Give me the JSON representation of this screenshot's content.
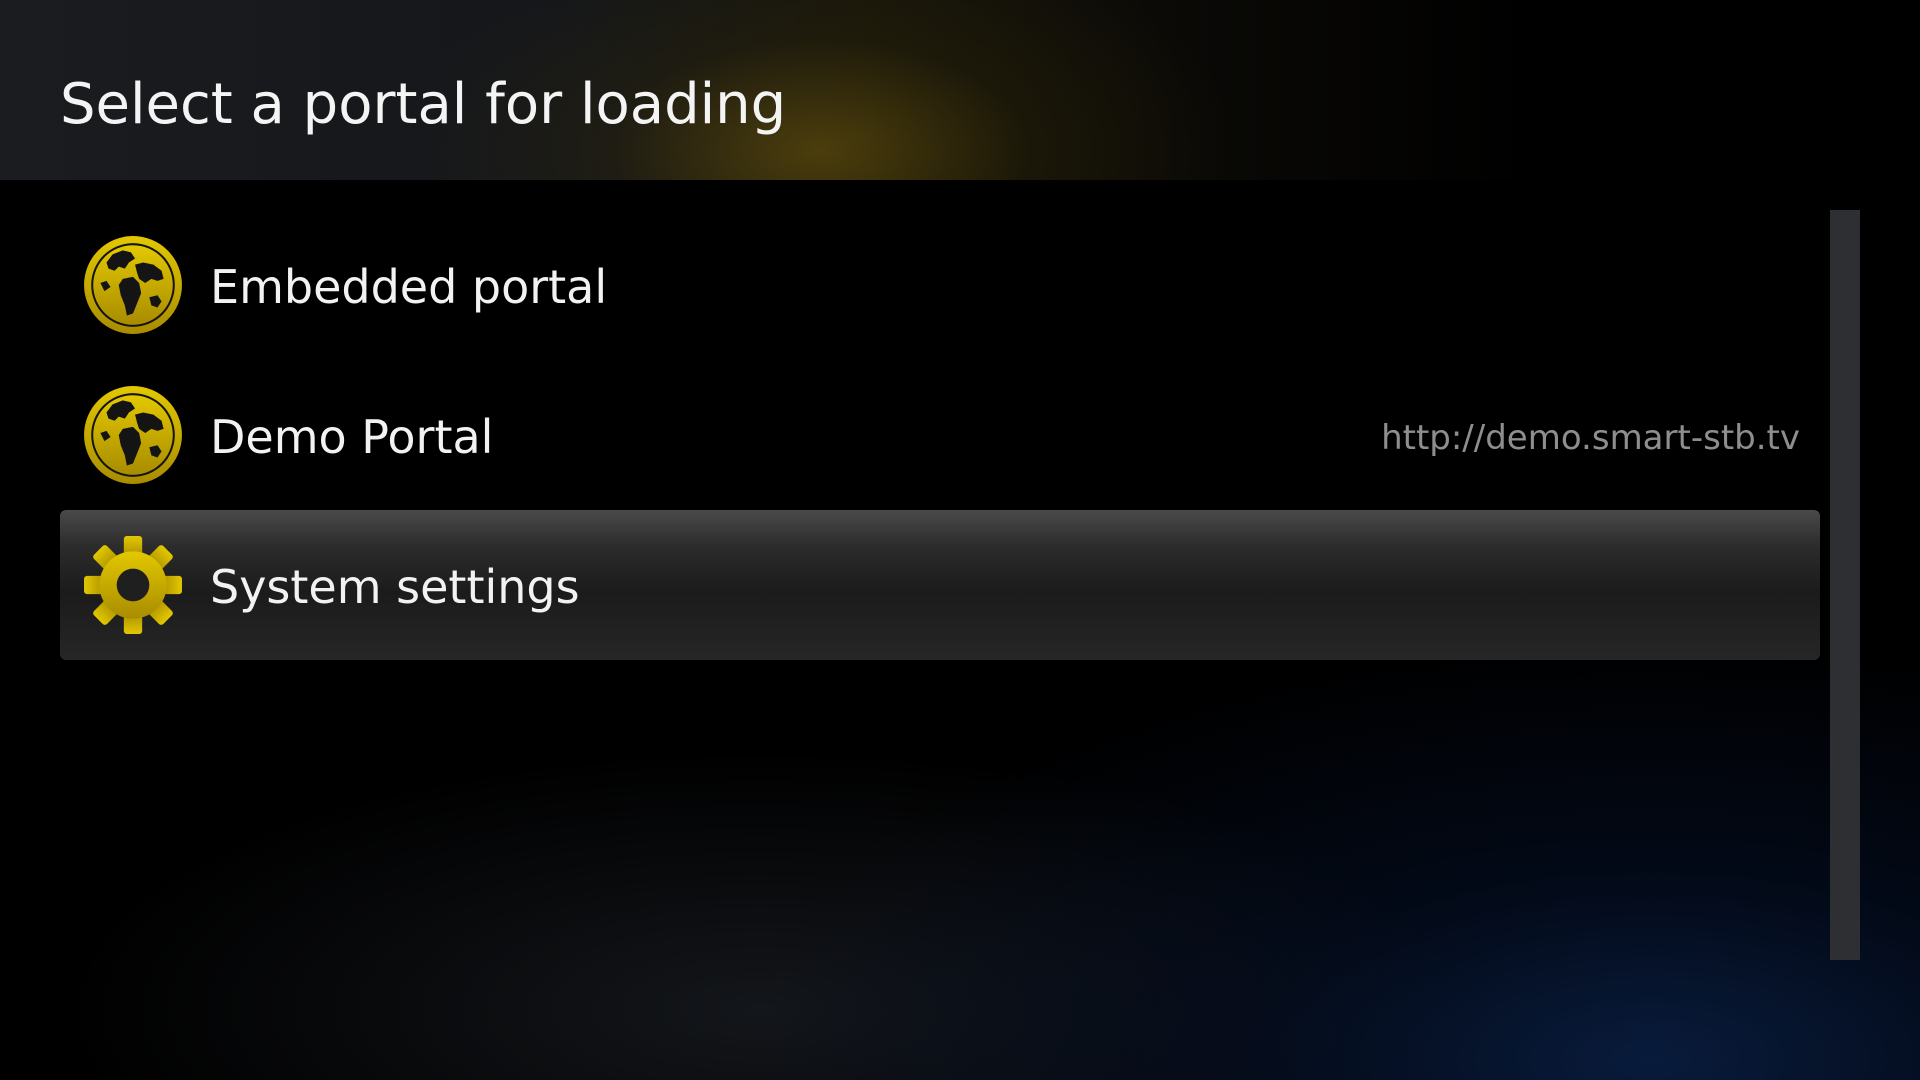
{
  "header": {
    "title": "Select a portal for loading"
  },
  "portals": [
    {
      "label": "Embedded portal",
      "url": "",
      "icon": "globe-icon",
      "selected": false
    },
    {
      "label": "Demo Portal",
      "url": "http://demo.smart-stb.tv",
      "icon": "globe-icon",
      "selected": false
    },
    {
      "label": "System settings",
      "url": "",
      "icon": "gear-icon",
      "selected": true
    }
  ],
  "colors": {
    "accent": "#d4b800",
    "selection": "#2c2c2c",
    "text": "#f2f2f2",
    "url_text": "#8e8e8e"
  }
}
